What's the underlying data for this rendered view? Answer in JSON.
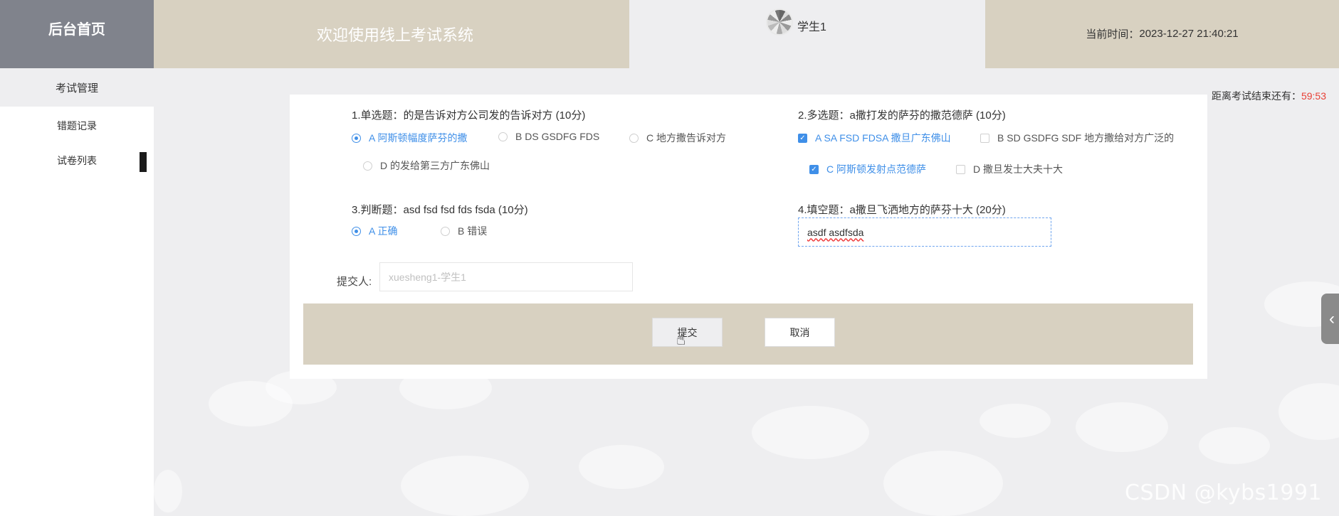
{
  "sidebar": {
    "logo": "后台首页",
    "items": [
      {
        "label": "考试管理"
      },
      {
        "label": "错题记录"
      },
      {
        "label": "试卷列表"
      }
    ]
  },
  "header": {
    "welcome": "欢迎使用线上考试系统",
    "user_name": "学生1",
    "time_label": "当前时间：",
    "time_value": "2023-12-27 21:40:21"
  },
  "countdown": {
    "label": "距离考试结束还有：",
    "value": "59:53"
  },
  "questions": {
    "q1": {
      "title": "1.单选题：的是告诉对方公司发的告诉对方 (10分)",
      "options": [
        {
          "label": "A 阿斯顿幅度萨芬的撒",
          "selected": true
        },
        {
          "label": "B DS GSDFG FDS",
          "selected": false
        },
        {
          "label": "C 地方撒告诉对方",
          "selected": false
        },
        {
          "label": "D 的发给第三方广东佛山",
          "selected": false
        }
      ]
    },
    "q2": {
      "title": "2.多选题：a撒打发的萨芬的撒范德萨 (10分)",
      "options": [
        {
          "label": "A SA FSD FDSA 撒旦广东佛山",
          "checked": true
        },
        {
          "label": "B SD GSDFG SDF 地方撒给对方广泛的",
          "checked": false
        },
        {
          "label": "C 阿斯顿发射点范德萨",
          "checked": true
        },
        {
          "label": "D 撒旦发士大夫十大",
          "checked": false
        }
      ]
    },
    "q3": {
      "title": "3.判断题：asd fsd fsd fds fsda (10分)",
      "options": [
        {
          "label": "A 正确",
          "selected": true
        },
        {
          "label": "B 错误",
          "selected": false
        }
      ]
    },
    "q4": {
      "title": "4.填空题：a撒旦飞洒地方的萨芬十大 (20分)",
      "value": "asdf asdfsda"
    }
  },
  "submitter": {
    "label": "提交人:",
    "placeholder": "xuesheng1-学生1"
  },
  "buttons": {
    "submit": "提交",
    "cancel": "取消"
  },
  "watermark": "CSDN @kybs1991",
  "colors": {
    "accent": "#3f8fe8",
    "countdown": "#e84036",
    "header_beige": "#d8d1c1",
    "logo_gray": "#80838c"
  }
}
